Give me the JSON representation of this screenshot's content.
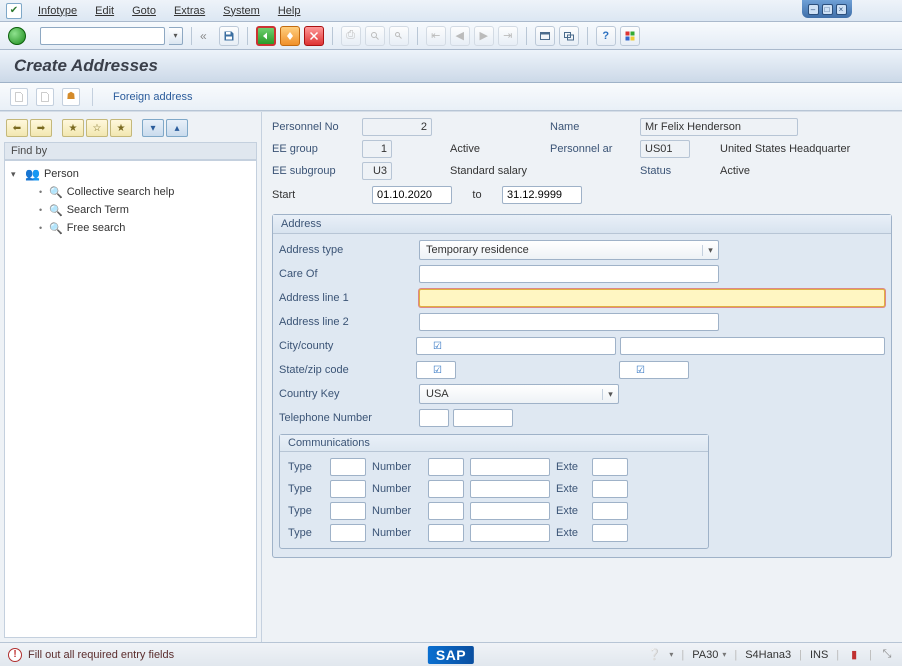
{
  "menu": {
    "items": [
      "Infotype",
      "Edit",
      "Goto",
      "Extras",
      "System",
      "Help"
    ]
  },
  "page_title": "Create Addresses",
  "toolbar2": {
    "foreign_address": "Foreign address"
  },
  "left": {
    "find_by": "Find by",
    "person": "Person",
    "items": [
      "Collective search help",
      "Search Term",
      "Free search"
    ]
  },
  "header": {
    "personnel_no_label": "Personnel No",
    "personnel_no": "2",
    "name_label": "Name",
    "name": "Mr Felix Henderson",
    "ee_group_label": "EE group",
    "ee_group": "1",
    "ee_group_text": "Active",
    "pers_area_label": "Personnel ar",
    "pers_area": "US01",
    "pers_area_text": "United States Headquarter",
    "ee_subgroup_label": "EE subgroup",
    "ee_subgroup": "U3",
    "ee_subgroup_text": "Standard salary",
    "status_label": "Status",
    "status": "Active",
    "start_label": "Start",
    "start": "01.10.2020",
    "to_label": "to",
    "end": "31.12.9999"
  },
  "address": {
    "group_title": "Address",
    "type_label": "Address type",
    "type_value": "Temporary residence",
    "care_of_label": "Care Of",
    "care_of": "",
    "line1_label": "Address line 1",
    "line1": "",
    "line2_label": "Address line 2",
    "line2": "",
    "city_label": "City/county",
    "city": "",
    "county": "",
    "state_label": "State/zip code",
    "state": "",
    "zip": "",
    "country_label": "Country Key",
    "country": "USA",
    "tel_label": "Telephone Number",
    "tel_area": "",
    "tel_num": ""
  },
  "comm": {
    "group_title": "Communications",
    "type_label": "Type",
    "number_label": "Number",
    "ext_label": "Exte",
    "rows": [
      {
        "type": "",
        "num_a": "",
        "num_b": "",
        "ext": ""
      },
      {
        "type": "",
        "num_a": "",
        "num_b": "",
        "ext": ""
      },
      {
        "type": "",
        "num_a": "",
        "num_b": "",
        "ext": ""
      },
      {
        "type": "",
        "num_a": "",
        "num_b": "",
        "ext": ""
      }
    ]
  },
  "status": {
    "message": "Fill out all required entry fields",
    "tcode": "PA30",
    "system": "S4Hana3",
    "mode": "INS"
  },
  "icons": {
    "dblleft": "«"
  }
}
